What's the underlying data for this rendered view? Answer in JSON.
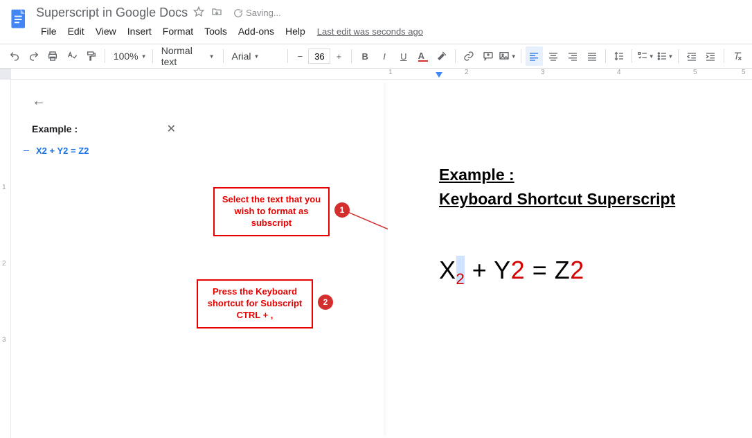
{
  "header": {
    "title": "Superscript in Google Docs",
    "saving": "Saving...",
    "last_edit": "Last edit was seconds ago",
    "menus": [
      "File",
      "Edit",
      "View",
      "Insert",
      "Format",
      "Tools",
      "Add-ons",
      "Help"
    ]
  },
  "toolbar": {
    "zoom": "100%",
    "style": "Normal text",
    "font": "Arial",
    "size": "36"
  },
  "outline": {
    "heading": "Example :",
    "item1": "X2 + Y2 = Z2"
  },
  "annotations": {
    "a1": "Select the text that you wish to format as subscript",
    "b1": "1",
    "a2": "Press the Keyboard shortcut for Subscript CTRL + ,",
    "b2": "2"
  },
  "doc": {
    "h1": "Example :",
    "h2": "Keyboard Shortcut Superscript",
    "eq": {
      "x": "X",
      "two": "2",
      "plus": " + ",
      "y": "Y",
      "eq": " = ",
      "z": "Z"
    }
  },
  "ruler": {
    "n1": "1",
    "n2": "2",
    "n3": "3",
    "n4": "4",
    "n5": "5"
  },
  "vruler": {
    "n1": "1",
    "n2": "2",
    "n3": "3"
  }
}
